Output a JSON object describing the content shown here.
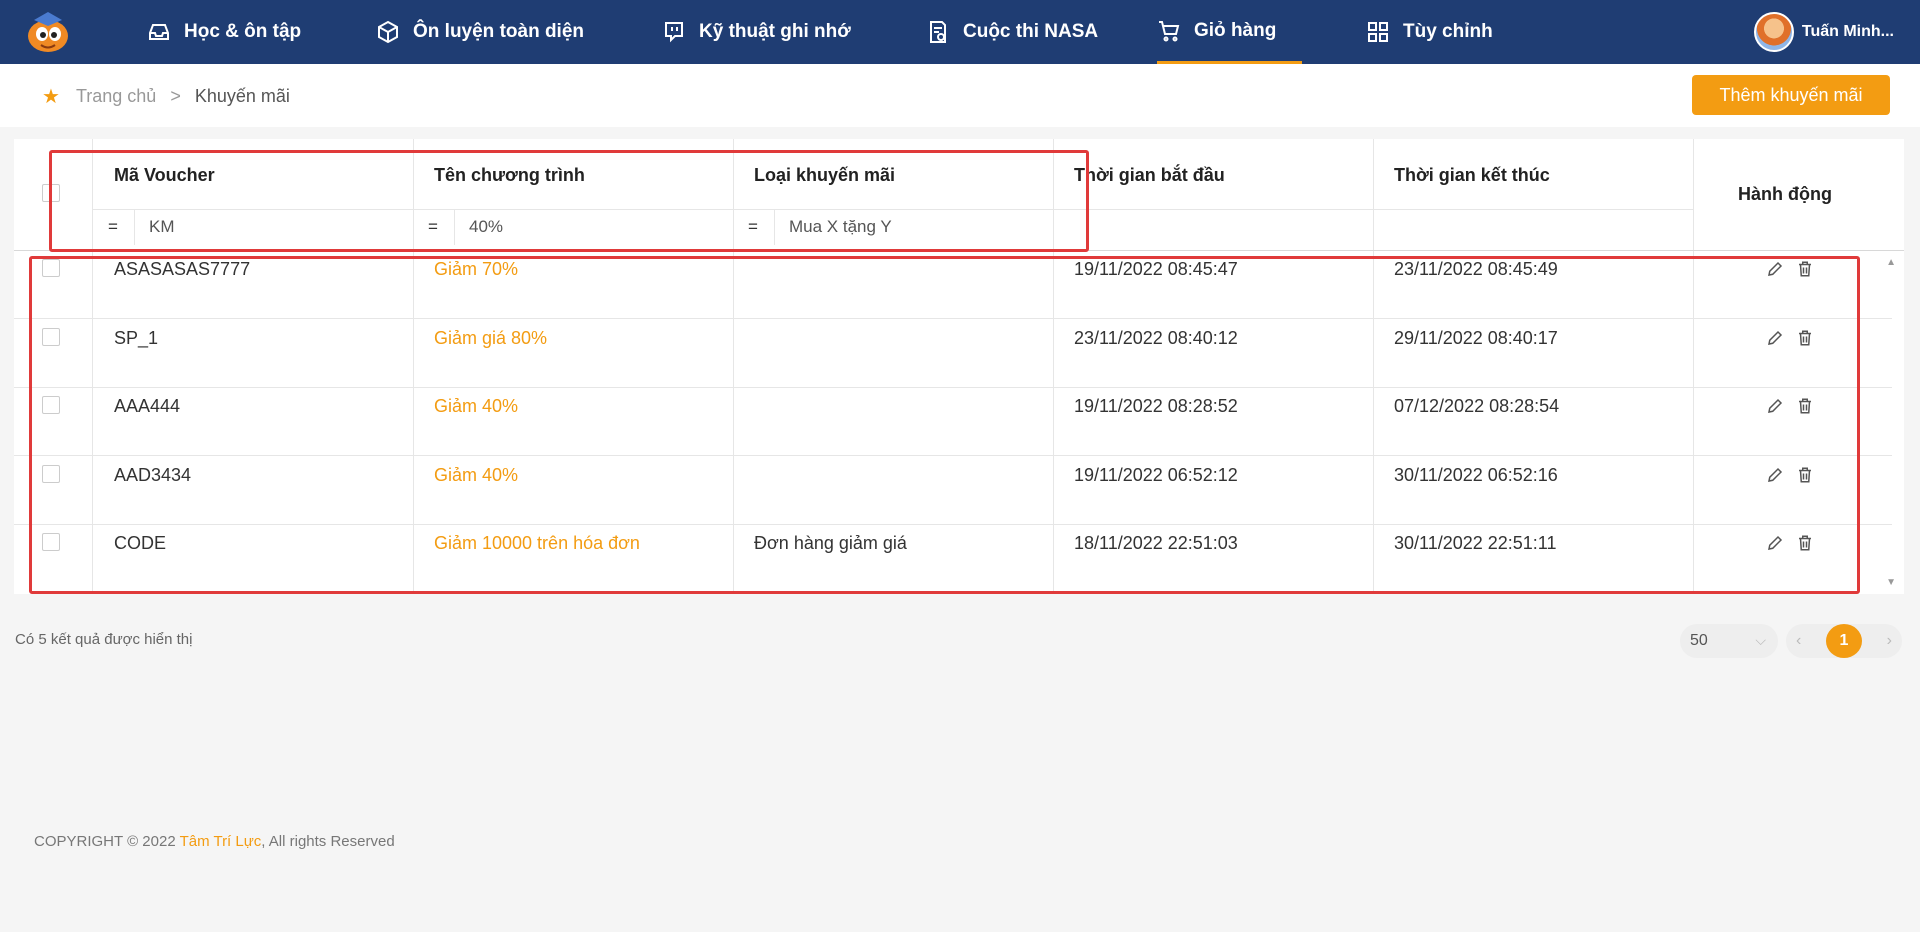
{
  "nav": {
    "items": [
      {
        "label": "Học & ôn tập",
        "icon": "inbox-icon"
      },
      {
        "label": "Ôn luyện toàn diện",
        "icon": "box-icon"
      },
      {
        "label": "Kỹ thuật ghi nhớ",
        "icon": "chat-icon"
      },
      {
        "label": "Cuộc thi NASA",
        "icon": "contest-icon"
      },
      {
        "label": "Giỏ hàng",
        "icon": "cart-icon",
        "active": true
      },
      {
        "label": "Tùy chỉnh",
        "icon": "grid-icon"
      }
    ],
    "user_name": "Tuấn Minh..."
  },
  "breadcrumb": {
    "home": "Trang chủ",
    "separator": ">",
    "current": "Khuyến mãi"
  },
  "toolbar": {
    "add_label": "Thêm khuyến mãi"
  },
  "table": {
    "columns": {
      "voucher": "Mã Voucher",
      "program": "Tên chương trình",
      "type": "Loại khuyến mãi",
      "start": "Thời gian bắt đầu",
      "end": "Thời gian kết thúc",
      "actions": "Hành động"
    },
    "filters": {
      "operator": "=",
      "voucher": "KM",
      "program": "40%",
      "type": "Mua X tặng Y"
    },
    "rows": [
      {
        "voucher": "ASASASAS7777",
        "program": "Giảm 70%",
        "type": "",
        "start": "19/11/2022 08:45:47",
        "end": "23/11/2022 08:45:49"
      },
      {
        "voucher": "SP_1",
        "program": "Giảm giá 80%",
        "type": "",
        "start": "23/11/2022 08:40:12",
        "end": "29/11/2022 08:40:17"
      },
      {
        "voucher": "AAA444",
        "program": "Giảm 40%",
        "type": "",
        "start": "19/11/2022 08:28:52",
        "end": "07/12/2022 08:28:54"
      },
      {
        "voucher": "AAD3434",
        "program": "Giảm 40%",
        "type": "",
        "start": "19/11/2022 06:52:12",
        "end": "30/11/2022 06:52:16"
      },
      {
        "voucher": "CODE",
        "program": "Giảm 10000 trên hóa đơn",
        "type": "Đơn hàng giảm giá",
        "start": "18/11/2022 22:51:03",
        "end": "30/11/2022 22:51:11"
      }
    ]
  },
  "footer": {
    "result_text": "Có 5 kết quả được hiển thị",
    "page_size": "50",
    "current_page": "1",
    "copyright_prefix": "COPYRIGHT © 2022 ",
    "copyright_brand": "Tâm Trí Lực",
    "copyright_suffix": ", All rights Reserved"
  },
  "colors": {
    "nav_bg": "#1f3d73",
    "accent": "#f39c12",
    "highlight": "#e03a3a"
  }
}
